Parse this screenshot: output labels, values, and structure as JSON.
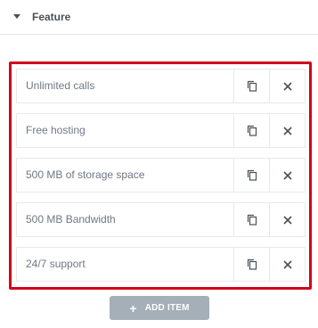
{
  "section": {
    "title": "Feature",
    "caret_icon": "caret-down-icon"
  },
  "items": [
    {
      "label": "Unlimited calls"
    },
    {
      "label": "Free hosting"
    },
    {
      "label": "500 MB of storage space"
    },
    {
      "label": "500 MB Bandwidth"
    },
    {
      "label": "24/7 support"
    }
  ],
  "actions": {
    "duplicate_icon": "copy-icon",
    "remove_icon": "close-icon"
  },
  "add_button": {
    "plus": "+",
    "label": "ADD ITEM"
  },
  "colors": {
    "highlight_border": "#d0021b",
    "add_button_bg": "#a4afb7",
    "text": "#6d7882"
  }
}
